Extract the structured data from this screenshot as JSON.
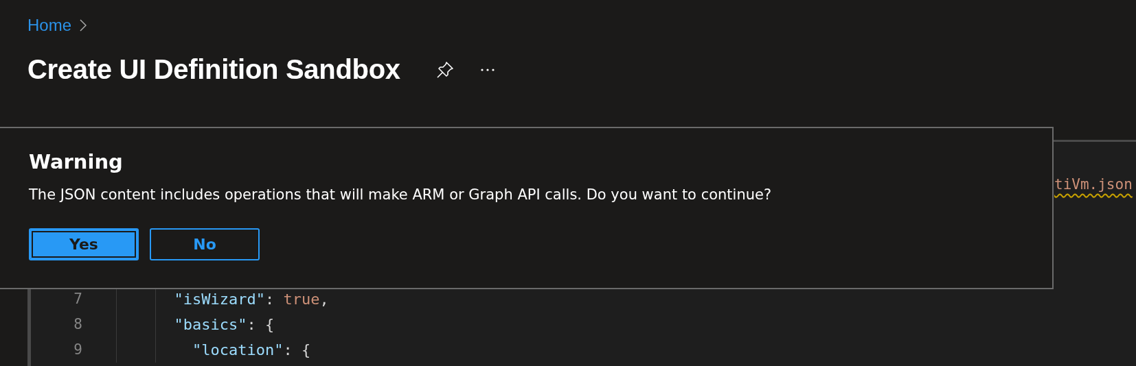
{
  "breadcrumb": {
    "items": [
      "Home"
    ]
  },
  "title": "Create UI Definition Sandbox",
  "editor": {
    "file_line": "tiVm.json",
    "lines": [
      {
        "number": "7",
        "tokens": [
          {
            "kind": "key",
            "text": "      \"isWizard\""
          },
          {
            "kind": "punct",
            "text": ": "
          },
          {
            "kind": "value",
            "text": "true"
          },
          {
            "kind": "punct",
            "text": ","
          }
        ]
      },
      {
        "number": "8",
        "tokens": [
          {
            "kind": "key",
            "text": "      \"basics\""
          },
          {
            "kind": "punct",
            "text": ": {"
          }
        ]
      },
      {
        "number": "9",
        "tokens": [
          {
            "kind": "key",
            "text": "        \"location\""
          },
          {
            "kind": "punct",
            "text": ": {"
          }
        ]
      }
    ]
  },
  "dialog": {
    "title": "Warning",
    "message": "The JSON content includes operations that will make ARM or Graph API calls. Do you want to continue?",
    "buttons": [
      {
        "label": "Yes",
        "kind": "primary",
        "focused": true
      },
      {
        "label": "No",
        "kind": "default",
        "focused": false
      }
    ]
  }
}
